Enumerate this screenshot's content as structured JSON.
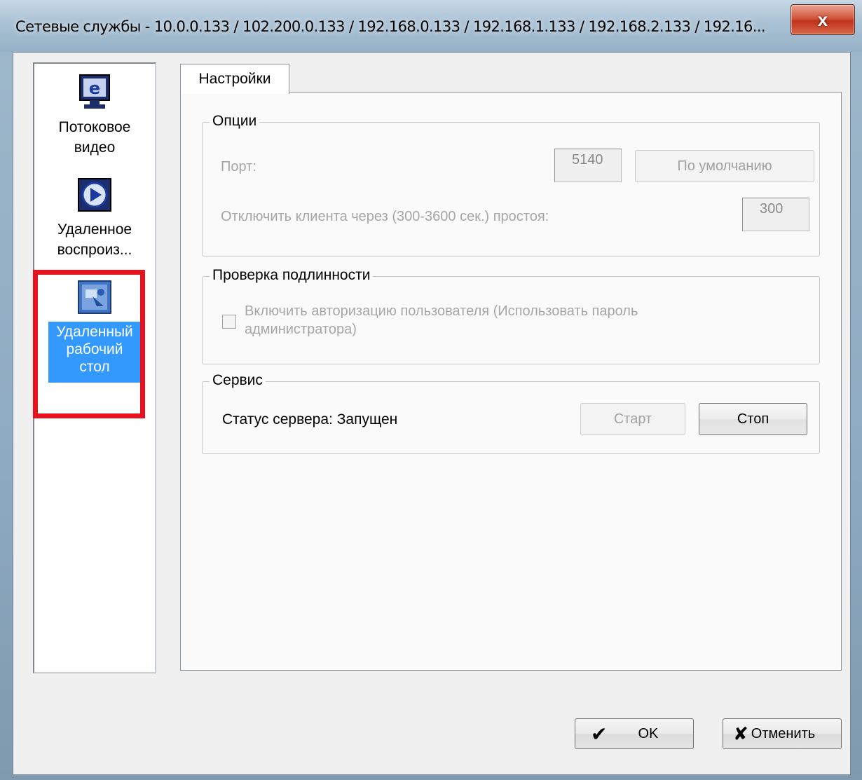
{
  "window": {
    "title": "Сетевые службы - 10.0.0.133 / 102.200.0.133 / 192.168.0.133 / 192.168.1.133 / 192.168.2.133 / 192.16...",
    "close_label": "x"
  },
  "sidebar": {
    "items": [
      {
        "label_line1": "Потоковое",
        "label_line2": "видео",
        "icon": "monitor-e-icon"
      },
      {
        "label_line1": "Удаленное",
        "label_line2": "воспроиз...",
        "icon": "play-icon"
      },
      {
        "label_line1": "Удаленный",
        "label_line2": "рабочий",
        "label_line3": "стол",
        "icon": "remote-desktop-icon",
        "selected": true
      }
    ]
  },
  "tabs": [
    {
      "label": "Настройки",
      "active": true
    }
  ],
  "options": {
    "title": "Опции",
    "port_label": "Порт:",
    "port_value": "5140",
    "default_button": "По умолчанию",
    "idle_label": "Отключить клиента через (300-3600 сек.) простоя:",
    "idle_value": "300"
  },
  "auth": {
    "title": "Проверка подлинности",
    "checkbox_line1": "Включить авторизацию пользователя (Использовать пароль",
    "checkbox_line2": "администратора)",
    "checked": false
  },
  "service": {
    "title": "Сервис",
    "status": "Статус сервера: Запущен",
    "start_button": "Старт",
    "stop_button": "Стоп"
  },
  "footer": {
    "ok_icon": "✔",
    "ok_label": "OK",
    "cancel_icon": "✘",
    "cancel_label": "Отменить"
  },
  "colors": {
    "selection": "#3399ff",
    "highlight_border": "#e8121e"
  }
}
